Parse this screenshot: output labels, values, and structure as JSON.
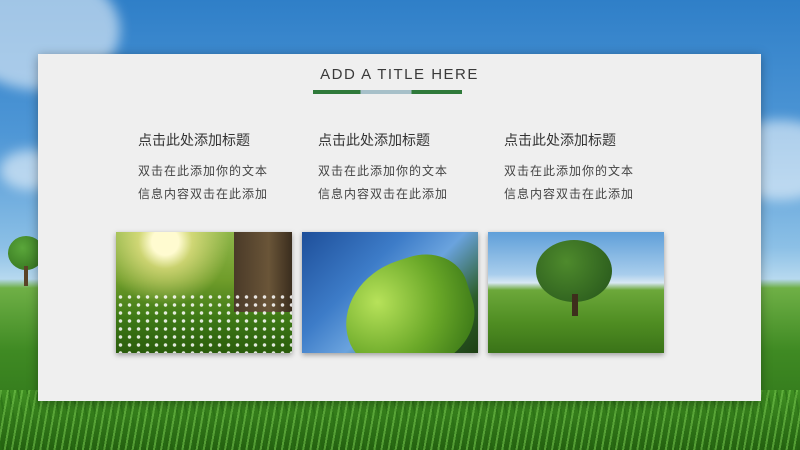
{
  "slide": {
    "title": "ADD A TITLE HERE",
    "columns": [
      {
        "heading": "点击此处添加标题",
        "body_line1": "双击在此添加你的文本",
        "body_line2": "信息内容双击在此添加"
      },
      {
        "heading": "点击此处添加标题",
        "body_line1": "双击在此添加你的文本",
        "body_line2": "信息内容双击在此添加"
      },
      {
        "heading": "点击此处添加标题",
        "body_line1": "双击在此添加你的文本",
        "body_line2": "信息内容双击在此添加"
      }
    ],
    "colors": {
      "accent_green": "#2f7a3a",
      "panel_bg": "#efefef",
      "accent_grey_blue": "#a7c0c9"
    }
  }
}
